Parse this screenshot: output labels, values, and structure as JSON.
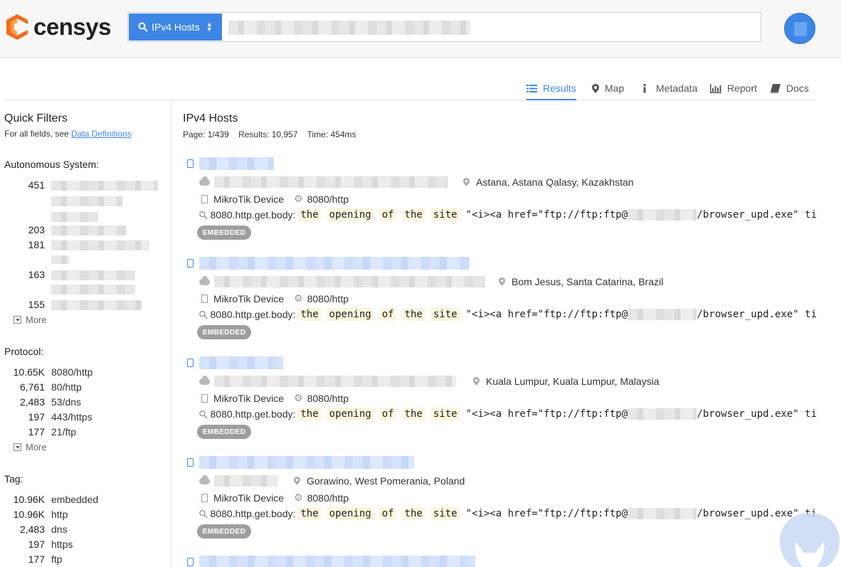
{
  "app": {
    "name": "censys"
  },
  "search": {
    "type_label": "IPv4 Hosts"
  },
  "tabs": [
    {
      "label": "Results",
      "icon": "list-icon",
      "active": true
    },
    {
      "label": "Map",
      "icon": "map-pin-icon"
    },
    {
      "label": "Metadata",
      "icon": "info-icon"
    },
    {
      "label": "Report",
      "icon": "bar-chart-icon"
    },
    {
      "label": "Docs",
      "icon": "book-icon"
    }
  ],
  "sidebar": {
    "title": "Quick Filters",
    "subtitle_prefix": "For all fields, see ",
    "subtitle_link": "Data Definitions",
    "autonomous": {
      "title": "Autonomous System:",
      "counts": [
        "451",
        "203",
        "181",
        "163",
        "155"
      ],
      "more": "More"
    },
    "protocol": {
      "title": "Protocol:",
      "rows": [
        {
          "count": "10.65K",
          "label": "8080/http"
        },
        {
          "count": "6,761",
          "label": "80/http"
        },
        {
          "count": "2,483",
          "label": "53/dns"
        },
        {
          "count": "197",
          "label": "443/https"
        },
        {
          "count": "177",
          "label": "21/ftp"
        }
      ],
      "more": "More"
    },
    "tag": {
      "title": "Tag:",
      "rows": [
        {
          "count": "10.96K",
          "label": "embedded"
        },
        {
          "count": "10.96K",
          "label": "http"
        },
        {
          "count": "2,483",
          "label": "dns"
        },
        {
          "count": "197",
          "label": "https"
        },
        {
          "count": "177",
          "label": "ftp"
        }
      ]
    }
  },
  "main": {
    "title": "IPv4 Hosts",
    "page": "Page: 1/439",
    "results": "Results: 10,957",
    "time": "Time: 454ms"
  },
  "results": [
    {
      "location": "Astana, Astana Qalasy, Kazakhstan",
      "device": "MikroTik Device",
      "port": "8080/http",
      "field": "8080.http.get.body:",
      "words": [
        "the",
        "opening",
        "of",
        "the",
        "site"
      ],
      "code_start": "\"<i><a href=\"ftp://ftp:ftp@",
      "code_end": "/browser_upd.exe\" ti",
      "badge": "EMBEDDED"
    },
    {
      "location": "Bom Jesus, Santa Catarina, Brazil",
      "device": "MikroTik Device",
      "port": "8080/http",
      "field": "8080.http.get.body:",
      "words": [
        "the",
        "opening",
        "of",
        "the",
        "site"
      ],
      "code_start": "\"<i><a href=\"ftp://ftp:ftp@",
      "code_end": "/browser_upd.exe\" ti",
      "badge": "EMBEDDED"
    },
    {
      "location": "Kuala Lumpur, Kuala Lumpur, Malaysia",
      "device": "MikroTik Device",
      "port": "8080/http",
      "field": "8080.http.get.body:",
      "words": [
        "the",
        "opening",
        "of",
        "the",
        "site"
      ],
      "code_start": "\"<i><a href=\"ftp://ftp:ftp@",
      "code_end": "/browser_upd.exe\" ti",
      "badge": "EMBEDDED"
    },
    {
      "location": "Gorawino, West Pomerania, Poland",
      "device": "MikroTik Device",
      "port": "8080/http",
      "field": "8080.http.get.body:",
      "words": [
        "the",
        "opening",
        "of",
        "the",
        "site"
      ],
      "code_start": "\"<i><a href=\"ftp://ftp:ftp@",
      "code_end": "/browser_upd.exe\" ti",
      "badge": "EMBEDDED"
    }
  ],
  "colors": {
    "accent": "#3d86e6",
    "logo_orange": "#f26b1d",
    "badge": "#9e9e9e",
    "highlight": "#fdf5dc"
  }
}
